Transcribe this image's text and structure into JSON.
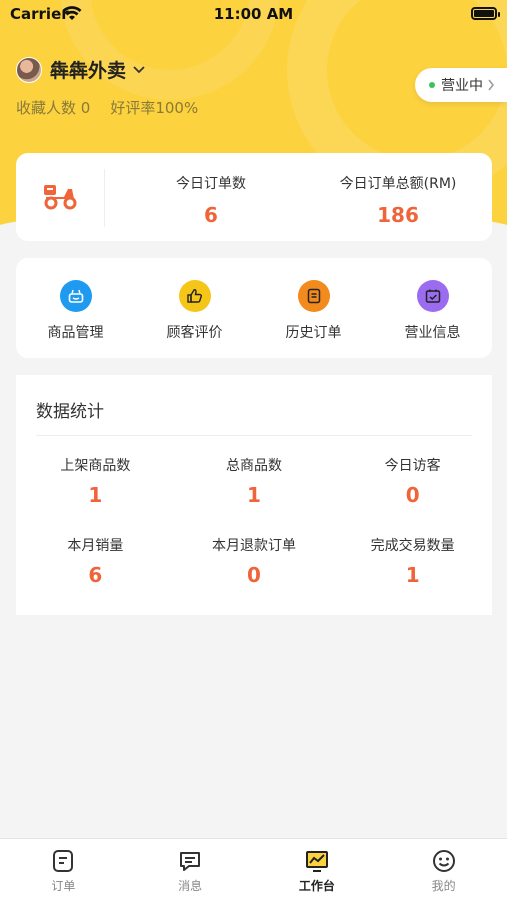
{
  "status_bar": {
    "carrier": "Carrier",
    "time": "11:00 AM"
  },
  "store": {
    "name": "犇犇外卖",
    "favorites_label": "收藏人数 0",
    "rating_label": "好评率100%",
    "status_text": "营业中"
  },
  "today": {
    "orders_label": "今日订单数",
    "orders_value": "6",
    "amount_label": "今日订单总额(RM)",
    "amount_value": "186"
  },
  "shortcuts": [
    {
      "label": "商品管理",
      "icon": "basket-icon",
      "color": "#1e9bf0"
    },
    {
      "label": "顾客评价",
      "icon": "thumbs-up-icon",
      "color": "#f5c518"
    },
    {
      "label": "历史订单",
      "icon": "order-list-icon",
      "color": "#f28a1e"
    },
    {
      "label": "营业信息",
      "icon": "calendar-check-icon",
      "color": "#9b6cf0"
    }
  ],
  "statistics": {
    "title": "数据统计",
    "items": [
      {
        "label": "上架商品数",
        "value": "1"
      },
      {
        "label": "总商品数",
        "value": "1"
      },
      {
        "label": "今日访客",
        "value": "0"
      },
      {
        "label": "本月销量",
        "value": "6"
      },
      {
        "label": "本月退款订单",
        "value": "0"
      },
      {
        "label": "完成交易数量",
        "value": "1"
      }
    ]
  },
  "tabbar": {
    "items": [
      {
        "label": "订单",
        "icon": "order-icon",
        "active": false
      },
      {
        "label": "消息",
        "icon": "message-icon",
        "active": false
      },
      {
        "label": "工作台",
        "icon": "dashboard-icon",
        "active": true
      },
      {
        "label": "我的",
        "icon": "smiley-icon",
        "active": false
      }
    ]
  },
  "colors": {
    "brand_yellow": "#fcd23f",
    "accent_orange": "#f0643a",
    "online_green": "#3cc25a"
  }
}
